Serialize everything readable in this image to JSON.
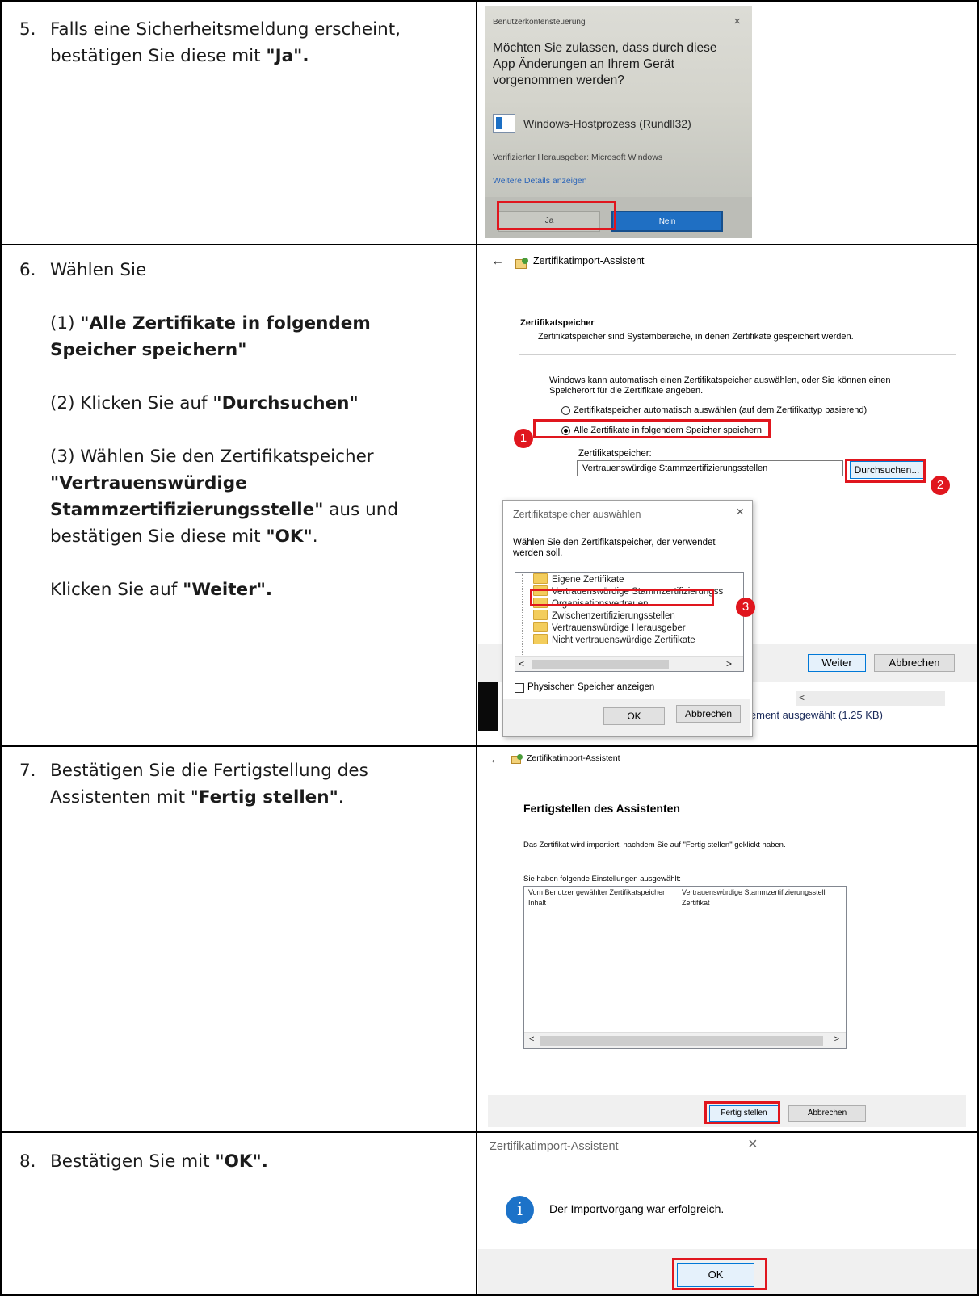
{
  "rows": [
    {
      "number": "5.",
      "text_plain": "Falls eine Sicherheitsmeldung erscheint, bestätigen Sie diese mit ",
      "text_bold": "\"Ja\".",
      "screenshot": {
        "caption": "Benutzerkontensteuerung",
        "close_glyph": "×",
        "question": "Möchten Sie zulassen, dass durch diese App Änderungen an Ihrem Gerät vorgenommen werden?",
        "app_name": "Windows-Hostprozess (Rundll32)",
        "publisher": "Verifizierter Herausgeber: Microsoft Windows",
        "details_link": "Weitere Details anzeigen",
        "yes_button": "Ja",
        "no_button": "Nein"
      }
    },
    {
      "number": "6.",
      "intro": "Wählen Sie",
      "step1_prefix": "(1) ",
      "step1_bold": "\"Alle Zertifikate in folgendem Speicher speichern\"",
      "step2_prefix": "(2) Klicken Sie auf ",
      "step2_bold": "\"Durchsuchen\"",
      "step3_prefix": "(3) Wählen Sie den Zertifikatspeicher ",
      "step3_bold": "\"Vertrauenswürdige Stammzertifizierungsstelle\"",
      "step3_mid": " aus und bestätigen Sie diese mit ",
      "step3_ok": "\"OK\"",
      "step3_end": ".",
      "next_prefix": "Klicken Sie auf ",
      "next_bold": "\"Weiter\".",
      "screenshot": {
        "back_glyph": "←",
        "wizard_title": "Zertifikatimport-Assistent",
        "section_title": "Zertifikatspeicher",
        "section_desc": "Zertifikatspeicher sind Systembereiche, in denen Zertifikate gespeichert werden.",
        "info_line1": "Windows kann automatisch einen Zertifikatspeicher auswählen, oder Sie können einen",
        "info_line2": "Speicherort für die Zertifikate angeben.",
        "radio_auto": "Zertifikatspeicher automatisch auswählen (auf dem Zertifikattyp basierend)",
        "radio_manual": "Alle Zertifikate in folgendem Speicher speichern",
        "store_label": "Zertifikatspeicher:",
        "store_value": "Vertrauenswürdige Stammzertifizierungsstellen",
        "browse_button": "Durchsuchen...",
        "badge1": "1",
        "badge2": "2",
        "badge3": "3",
        "next_button": "Weiter",
        "cancel_button": "Abbrechen",
        "status_text": "lement ausgewählt (1.25 KB)",
        "popup": {
          "title": "Zertifikatspeicher auswählen",
          "close_glyph": "×",
          "desc_line1": "Wählen Sie den Zertifikatspeicher, der verwendet",
          "desc_line2": "werden soll.",
          "items": [
            "Eigene Zertifikate",
            "Vertrauenswürdige Stammzertifizierungss",
            "Organisationsvertrauen",
            "Zwischenzertifizierungsstellen",
            "Vertrauenswürdige Herausgeber",
            "Nicht vertrauenswürdige Zertifikate"
          ],
          "checkbox_label": "Physischen Speicher anzeigen",
          "ok_button": "OK",
          "cancel_button": "Abbrechen"
        }
      }
    },
    {
      "number": "7.",
      "text_plain": "Bestätigen Sie die Fertigstellung des Assistenten mit \"",
      "text_bold": "Fertig stellen\"",
      "text_end": ".",
      "screenshot": {
        "back_glyph": "←",
        "wizard_title": "Zertifikatimport-Assistent",
        "heading": "Fertigstellen des Assistenten",
        "desc": "Das Zertifikat wird importiert, nachdem Sie auf \"Fertig stellen\" geklickt haben.",
        "settings_label": "Sie haben folgende Einstellungen ausgewählt:",
        "settings": [
          {
            "key": "Vom Benutzer gewählter Zertifikatspeicher",
            "value": "Vertrauenswürdige Stammzertifizierungsstell"
          },
          {
            "key": "Inhalt",
            "value": "Zertifikat"
          }
        ],
        "finish_button": "Fertig stellen",
        "cancel_button": "Abbrechen"
      }
    },
    {
      "number": "8.",
      "text_plain": "Bestätigen Sie mit ",
      "text_bold": "\"OK\".",
      "screenshot": {
        "title": "Zertifikatimport-Assistent",
        "close_glyph": "×",
        "info_glyph": "i",
        "message": "Der Importvorgang war erfolgreich.",
        "ok_button": "OK"
      }
    }
  ]
}
